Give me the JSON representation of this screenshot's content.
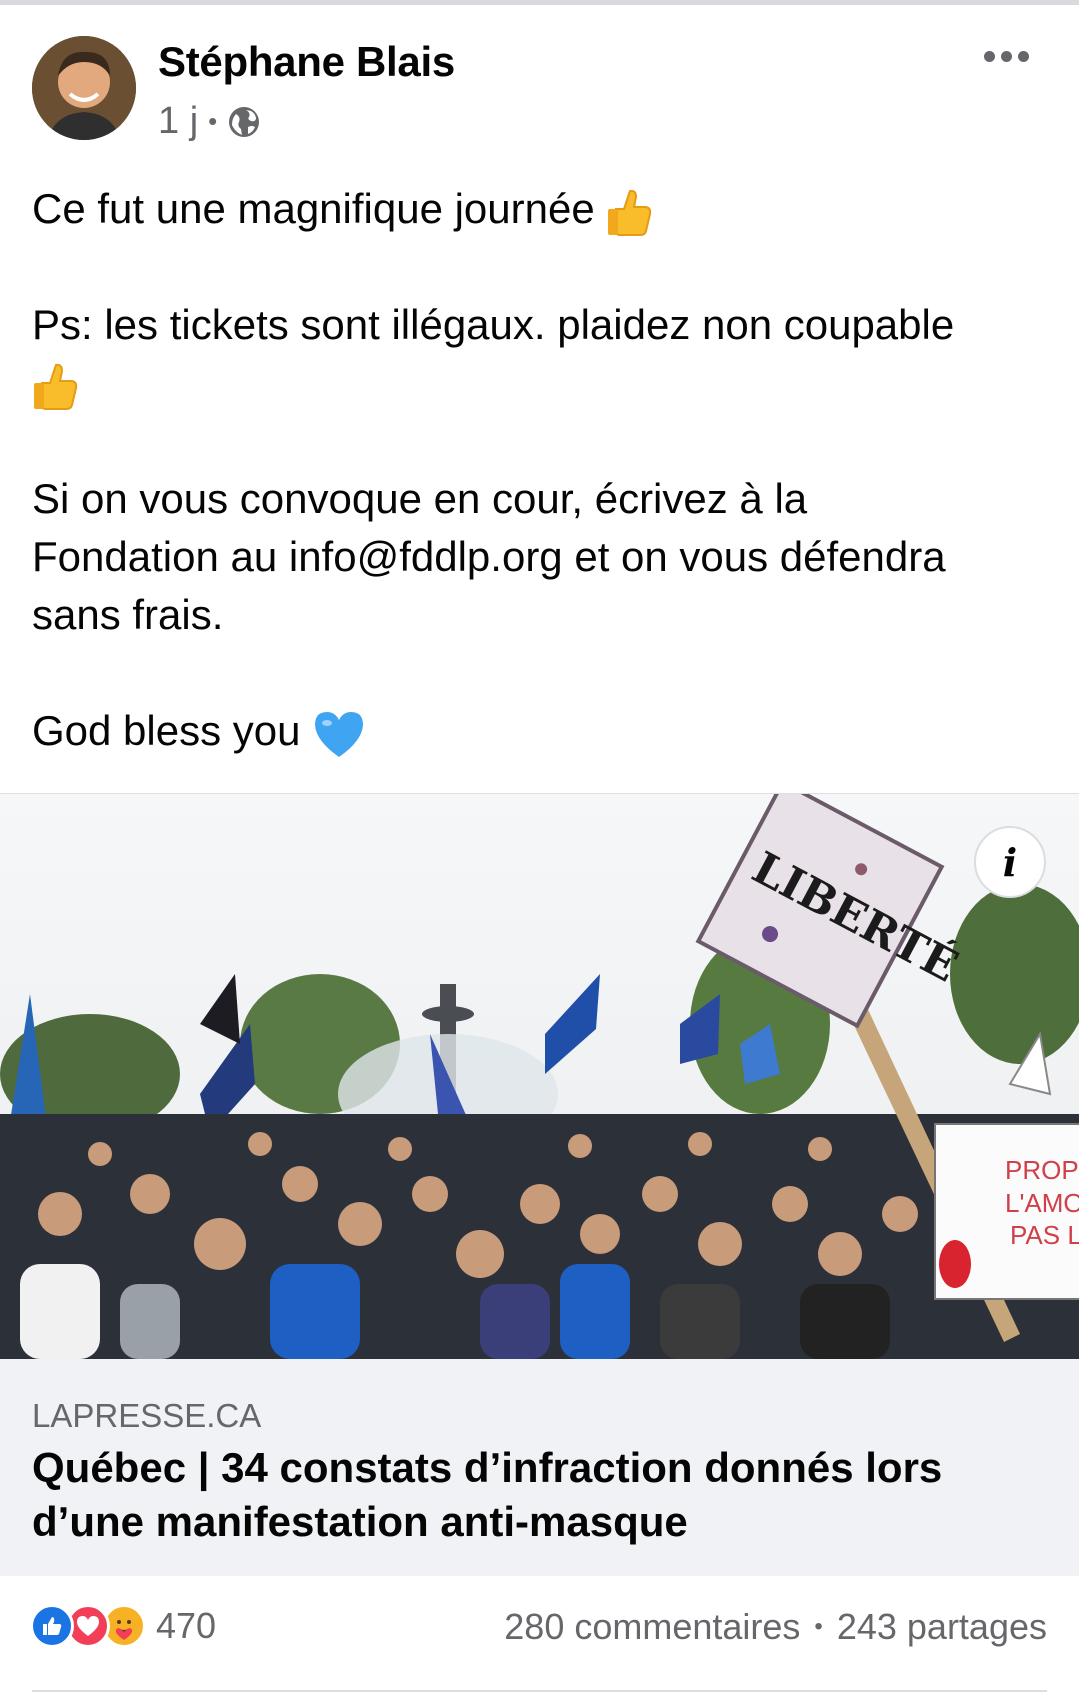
{
  "post": {
    "author": "Stéphane Blais",
    "time": "1 j",
    "privacy_icon": "globe-icon",
    "lines": {
      "l1": "Ce fut une magnifique journée",
      "l2": "Ps: les tickets sont illégaux. plaidez non coupable",
      "l3a": "Si on vous convoque en cour, écrivez à la",
      "l3b": "Fondation au info@fddlp.org et on vous défendra",
      "l3c": "sans frais.",
      "l4": "God bless you"
    }
  },
  "link": {
    "domain": "LAPRESSE.CA",
    "title": "Québec | 34 constats d’infraction donnés lors d’une manifestation anti-masque",
    "image_sign_text": "LIBERTÉ",
    "image_sign2_lines": [
      "PROP",
      "L'AMO",
      "PAS L"
    ]
  },
  "footer": {
    "reaction_count": "470",
    "comments": "280 commentaires",
    "shares": "243 partages"
  },
  "colors": {
    "like_blue": "#1b74e4",
    "love_red": "#f33e58",
    "care_yellow": "#f7b125",
    "secondary_text": "#65676b"
  }
}
